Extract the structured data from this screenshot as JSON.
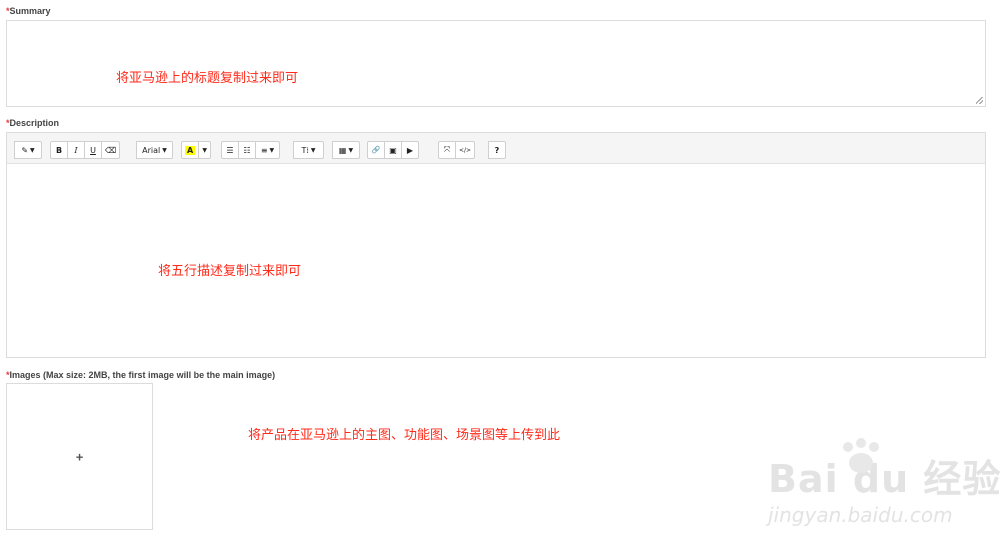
{
  "summary": {
    "required_mark": "*",
    "label": "Summary",
    "note": "将亚马逊上的标题复制过来即可"
  },
  "description": {
    "required_mark": "*",
    "label": "Description",
    "note": "将五行描述复制过来即可",
    "toolbar": {
      "style": "✎",
      "bold": "B",
      "italic": "I",
      "underline": "U",
      "eraser": "⌫",
      "font": "Arial",
      "color_letter": "A",
      "ul": "☰",
      "ol": "☷",
      "align": "≡",
      "text_size": "T⁞",
      "table": "▦",
      "link": "🔗",
      "picture": "▣",
      "video": "▶",
      "fullscreen": "⤧",
      "code": "</>",
      "help": "?"
    }
  },
  "images": {
    "required_mark": "*",
    "label": "Images (Max size: 2MB, the first image will be the main image)",
    "add_symbol": "+",
    "note": "将产品在亚马逊上的主图、功能图、场景图等上传到此"
  },
  "watermark": {
    "brand": "Bai  du 经验",
    "url": "jingyan.baidu.com"
  },
  "colors": {
    "required": "#e4393c",
    "note": "#ff2a1a",
    "highlight": "#ffff00"
  }
}
